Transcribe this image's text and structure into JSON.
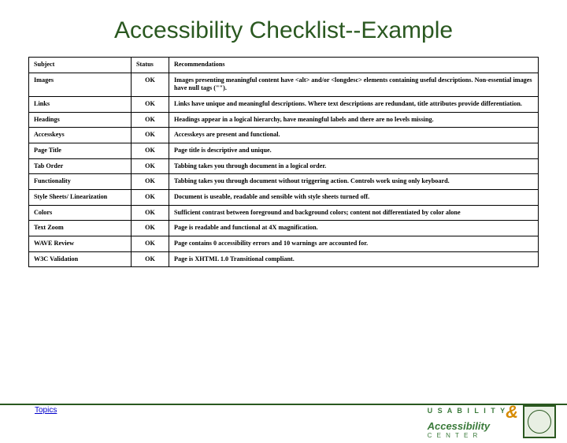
{
  "title": "Accessibility Checklist--Example",
  "headers": {
    "subject": "Subject",
    "status": "Status",
    "recommendations": "Recommendations"
  },
  "rows": [
    {
      "subject": "Images",
      "status": "OK",
      "rec": "Images presenting meaningful content have <alt> and/or <longdesc> elements containing useful descriptions. Non-essential images have null tags (\"\")."
    },
    {
      "subject": "Links",
      "status": "OK",
      "rec": "Links have unique and meaningful descriptions. Where text descriptions are redundant, title attributes provide differentiation."
    },
    {
      "subject": "Headings",
      "status": "OK",
      "rec": "Headings appear in a logical hierarchy, have meaningful labels and there are no levels missing."
    },
    {
      "subject": "Accesskeys",
      "status": "OK",
      "rec": "Accesskeys are present and functional."
    },
    {
      "subject": "Page Title",
      "status": "OK",
      "rec": "Page title is descriptive and unique."
    },
    {
      "subject": "Tab Order",
      "status": "OK",
      "rec": "Tabbing takes you through document in a logical order."
    },
    {
      "subject": "Functionality",
      "status": "OK",
      "rec": "Tabbing takes you through document without triggering action. Controls work using only keyboard."
    },
    {
      "subject": "Style Sheets/ Linearization",
      "status": "OK",
      "rec": "Document is useable, readable and sensible with style sheets turned off."
    },
    {
      "subject": "Colors",
      "status": "OK",
      "rec": "Sufficient contrast between foreground and background colors; content not differentiated by color alone"
    },
    {
      "subject": "Text Zoom",
      "status": "OK",
      "rec": "Page is readable and functional at 4X magnification."
    },
    {
      "subject": "WAVE Review",
      "status": "OK",
      "rec": "Page contains 0 accessibility errors and 10 warnings are accounted for."
    },
    {
      "subject": "W3C Validation",
      "status": "OK",
      "rec": "Page is XHTML 1.0 Transitional compliant."
    }
  ],
  "footer": {
    "topics_link": "Topics",
    "logo_usability": "U S A B I L I T Y",
    "logo_amp": "&",
    "logo_access": "Accessibility",
    "logo_center": "C   E   N   T   E   R"
  }
}
